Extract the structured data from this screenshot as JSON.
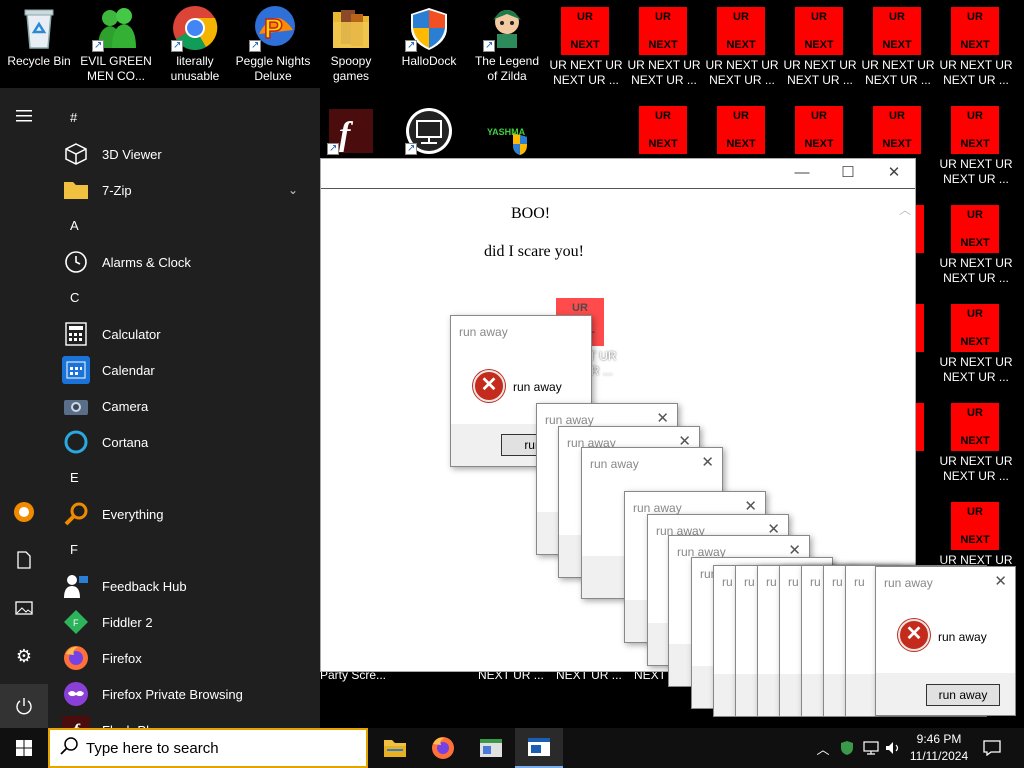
{
  "desktop": {
    "icons": [
      {
        "label": "Recycle Bin",
        "icon": "recycle-bin-icon"
      },
      {
        "label": "EVIL GREEN MEN CO...",
        "icon": "green-men-icon"
      },
      {
        "label": "literally unusable",
        "icon": "chrome-icon"
      },
      {
        "label": "Peggle Nights Deluxe",
        "icon": "peggle-icon"
      },
      {
        "label": "Spoopy games",
        "icon": "folder-icon"
      },
      {
        "label": "HalloDock",
        "icon": "shield-icon"
      },
      {
        "label": "The Legend of Zilda",
        "icon": "zilda-icon"
      }
    ],
    "row2_icons": [
      {
        "icon": "flash-icon"
      },
      {
        "icon": "network-icon"
      },
      {
        "label": "YASHMA",
        "icon": "yashma-icon"
      }
    ],
    "ur_tile": {
      "top": "UR",
      "bottom": "NEXT"
    },
    "ur_label": "UR NEXT UR NEXT UR ...",
    "ur_label_wrap": [
      "UR NEXT UR",
      "NEXT UR ..."
    ],
    "party_label": "Party Scre...",
    "next_label": "NEXT UR ...",
    "next_label_short": "NEXT U"
  },
  "start_menu": {
    "sections": [
      {
        "header": "#",
        "apps": [
          {
            "label": "3D Viewer",
            "icon": "cube-icon"
          },
          {
            "label": "7-Zip",
            "icon": "folder-icon",
            "expandable": true
          }
        ]
      },
      {
        "header": "A",
        "apps": [
          {
            "label": "Alarms & Clock",
            "icon": "clock-icon"
          }
        ]
      },
      {
        "header": "C",
        "apps": [
          {
            "label": "Calculator",
            "icon": "calculator-icon"
          },
          {
            "label": "Calendar",
            "icon": "calendar-icon"
          },
          {
            "label": "Camera",
            "icon": "camera-icon"
          },
          {
            "label": "Cortana",
            "icon": "cortana-icon"
          }
        ]
      },
      {
        "header": "E",
        "apps": [
          {
            "label": "Everything",
            "icon": "magnifier-icon"
          }
        ]
      },
      {
        "header": "F",
        "apps": [
          {
            "label": "Feedback Hub",
            "icon": "feedback-icon"
          },
          {
            "label": "Fiddler 2",
            "icon": "fiddler-icon"
          },
          {
            "label": "Firefox",
            "icon": "firefox-icon"
          },
          {
            "label": "Firefox Private Browsing",
            "icon": "firefox-private-icon"
          },
          {
            "label": "Flash Player",
            "icon": "flash-icon"
          }
        ]
      }
    ]
  },
  "window": {
    "line1": "BOO!",
    "line2": "did I scare you!",
    "minimize": "—",
    "maximize": "☐",
    "close": "✕"
  },
  "dialog": {
    "title": "run away",
    "message": "run away",
    "button": "run away",
    "button_partial": "run a",
    "title_partial": "ru"
  },
  "taskbar": {
    "search_placeholder": "Type here to search",
    "time": "9:46 PM",
    "date": "11/11/2024"
  },
  "colors": {
    "ur_red": "#ff0000",
    "error_red": "#c42b1c",
    "search_border": "#e5a400"
  }
}
